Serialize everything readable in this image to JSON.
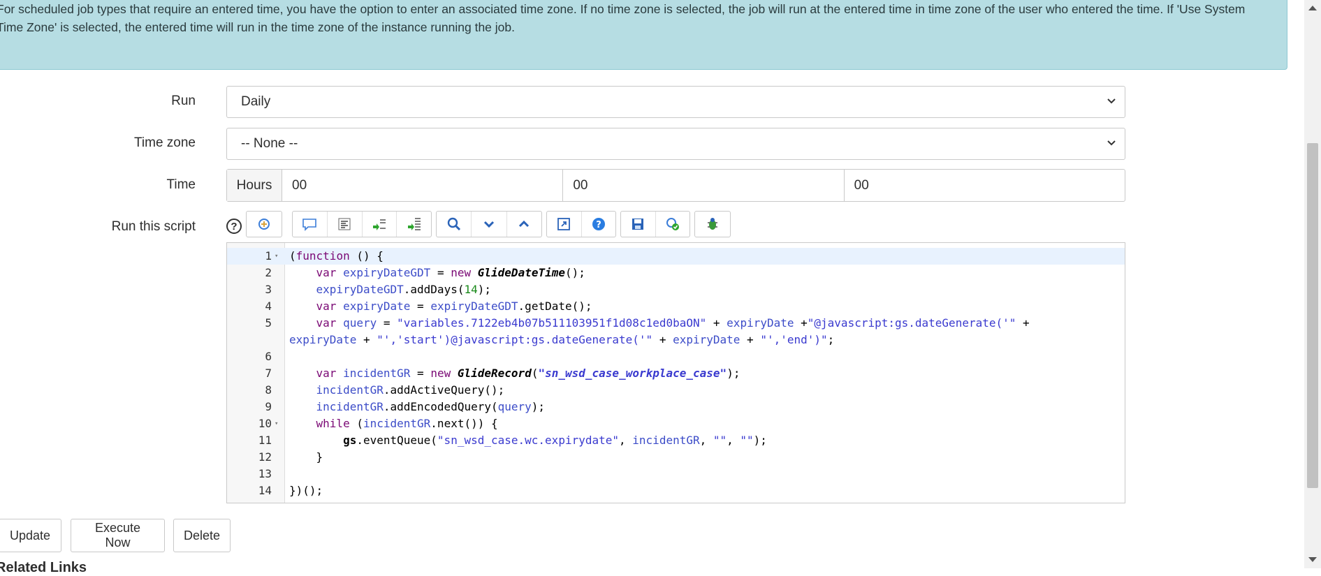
{
  "info": {
    "text": "For scheduled job types that require an entered time, you have the option to enter an associated time zone. If no time zone is selected, the job will run at the entered time in time zone of the user who entered the time. If 'Use System Time Zone' is selected, the entered time will run in the time zone of the instance running the job."
  },
  "form": {
    "run_label": "Run",
    "run_value": "Daily",
    "timezone_label": "Time zone",
    "timezone_value": "-- None --",
    "time_label": "Time",
    "time_addon": "Hours",
    "time_hours": "00",
    "time_minutes": "00",
    "time_seconds": "00",
    "script_label": "Run this script"
  },
  "toolbar": {
    "help_glyph": "?",
    "icons": [
      "toggle-syntax-icon",
      "comment-icon",
      "format-icon",
      "replace-icon",
      "replace-all-icon",
      "search-icon",
      "next-icon",
      "previous-icon",
      "fullscreen-icon",
      "help-icon",
      "save-icon",
      "script-debugger-icon",
      "debug-icon"
    ]
  },
  "editor": {
    "lines": [
      "1",
      "2",
      "3",
      "4",
      "5",
      "",
      "6",
      "7",
      "8",
      "9",
      "10",
      "11",
      "12",
      "13",
      "14"
    ]
  },
  "buttons": {
    "update": "Update",
    "execute_now": "Execute Now",
    "delete": "Delete"
  },
  "related_links": "Related Links"
}
